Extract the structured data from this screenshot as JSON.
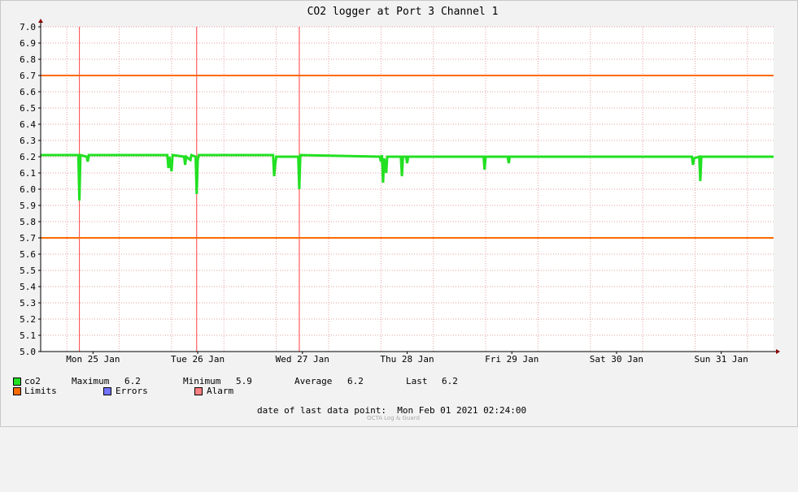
{
  "colors": {
    "background": "#f2f2f2",
    "canvas": "#ffffff",
    "grid": "#e6a0a0",
    "series": "#22e022",
    "limits": "#ff6a00",
    "errors": "#7373ff",
    "alarm": "#ff8080",
    "day_marker": "#ff4040"
  },
  "chart_data": {
    "type": "line",
    "title": "CO2 logger at Port 3 Channel 1",
    "xlabel": "",
    "ylabel": "",
    "ylim": [
      5.0,
      7.0
    ],
    "yticks": [
      "7.0",
      "6.9",
      "6.8",
      "6.7",
      "6.6",
      "6.5",
      "6.4",
      "6.3",
      "6.2",
      "6.1",
      "6.0",
      "5.9",
      "5.8",
      "5.7",
      "5.6",
      "5.5",
      "5.4",
      "5.3",
      "5.2",
      "5.1",
      "5.0"
    ],
    "xlim_days": [
      0,
      7.0
    ],
    "x_ticks": [
      {
        "label": "Mon 25 Jan",
        "day": 0.5
      },
      {
        "label": "Tue 26 Jan",
        "day": 1.5
      },
      {
        "label": "Wed 27 Jan",
        "day": 2.5
      },
      {
        "label": "Thu 28 Jan",
        "day": 3.5
      },
      {
        "label": "Fri 29 Jan",
        "day": 4.5
      },
      {
        "label": "Sat 30 Jan",
        "day": 5.5
      },
      {
        "label": "Sun 31 Jan",
        "day": 6.5
      }
    ],
    "grid": true,
    "limits": [
      6.7,
      5.7
    ],
    "alarm_markers_days": [
      0.37,
      1.49,
      2.47
    ],
    "series": [
      {
        "name": "co2",
        "baseline": 6.21,
        "points": [
          [
            0.0,
            6.21
          ],
          [
            0.36,
            6.21
          ],
          [
            0.37,
            5.93
          ],
          [
            0.38,
            6.21
          ],
          [
            0.44,
            6.2
          ],
          [
            0.45,
            6.17
          ],
          [
            0.46,
            6.21
          ],
          [
            1.21,
            6.21
          ],
          [
            1.22,
            6.13
          ],
          [
            1.23,
            6.2
          ],
          [
            1.25,
            6.11
          ],
          [
            1.26,
            6.21
          ],
          [
            1.37,
            6.2
          ],
          [
            1.38,
            6.15
          ],
          [
            1.39,
            6.2
          ],
          [
            1.43,
            6.18
          ],
          [
            1.44,
            6.21
          ],
          [
            1.48,
            6.2
          ],
          [
            1.49,
            5.97
          ],
          [
            1.5,
            6.18
          ],
          [
            1.51,
            6.21
          ],
          [
            2.22,
            6.21
          ],
          [
            2.23,
            6.08
          ],
          [
            2.24,
            6.15
          ],
          [
            2.25,
            6.2
          ],
          [
            2.46,
            6.2
          ],
          [
            2.47,
            6.0
          ],
          [
            2.48,
            6.21
          ],
          [
            3.24,
            6.2
          ],
          [
            3.25,
            6.17
          ],
          [
            3.26,
            6.21
          ],
          [
            3.27,
            6.04
          ],
          [
            3.28,
            6.19
          ],
          [
            3.29,
            6.15
          ],
          [
            3.3,
            6.1
          ],
          [
            3.31,
            6.2
          ],
          [
            3.44,
            6.2
          ],
          [
            3.45,
            6.08
          ],
          [
            3.46,
            6.2
          ],
          [
            3.49,
            6.2
          ],
          [
            3.5,
            6.16
          ],
          [
            3.51,
            6.2
          ],
          [
            4.23,
            6.2
          ],
          [
            4.24,
            6.12
          ],
          [
            4.25,
            6.2
          ],
          [
            4.46,
            6.2
          ],
          [
            4.47,
            6.16
          ],
          [
            4.48,
            6.2
          ],
          [
            6.22,
            6.2
          ],
          [
            6.23,
            6.15
          ],
          [
            6.24,
            6.19
          ],
          [
            6.29,
            6.2
          ],
          [
            6.3,
            6.05
          ],
          [
            6.31,
            6.2
          ],
          [
            7.0,
            6.2
          ]
        ]
      }
    ]
  },
  "legend": {
    "co2_label": "co2",
    "maximum_label": "Maximum",
    "maximum_value": "6.2",
    "minimum_label": "Minimum",
    "minimum_value": "5.9",
    "average_label": "Average",
    "average_value": "6.2",
    "last_label": "Last",
    "last_value": "6.2",
    "limits_label": "Limits",
    "errors_label": "Errors",
    "alarm_label": "Alarm"
  },
  "footer": {
    "date_label": "date of last data point:",
    "date_value": "Mon Feb 01 2021 02:24:00",
    "watermark": "OCTA Log & Guard"
  }
}
